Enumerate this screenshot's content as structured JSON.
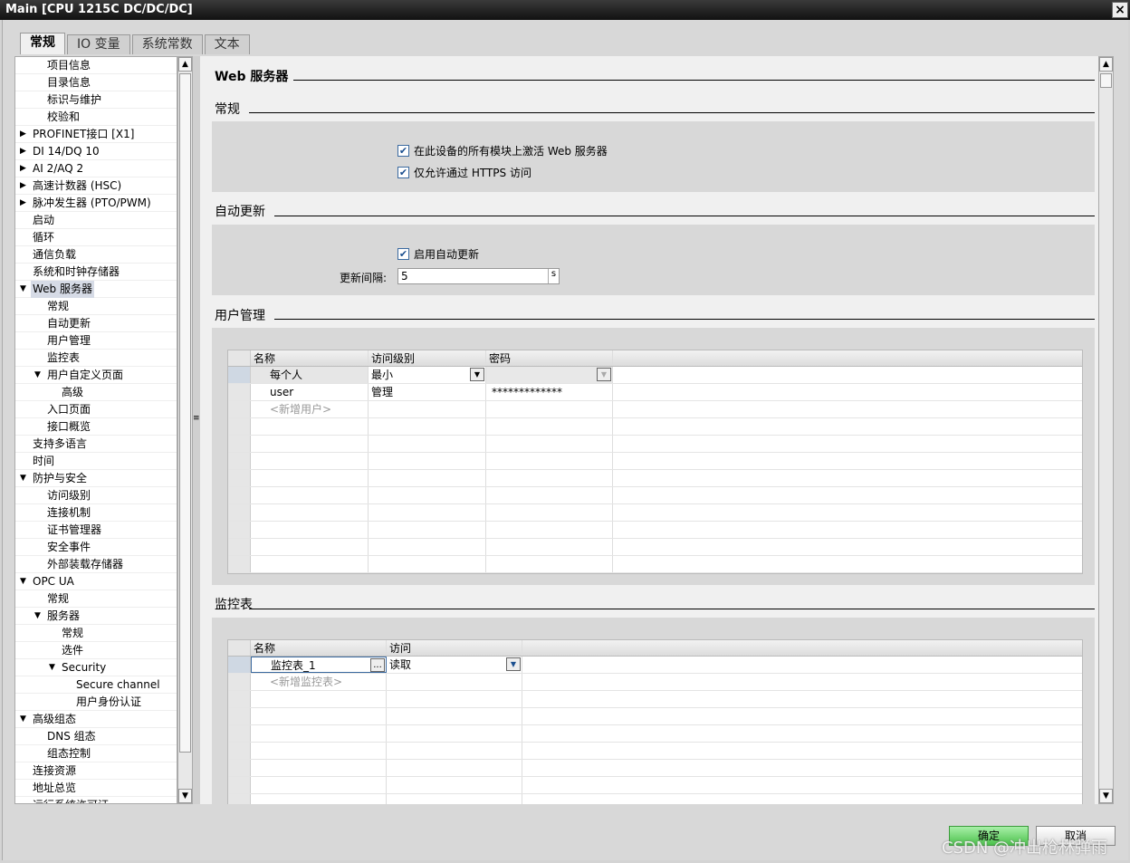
{
  "window": {
    "title": "Main [CPU 1215C DC/DC/DC]",
    "close": "×"
  },
  "tabs": [
    {
      "label": "常规",
      "active": true
    },
    {
      "label": "IO 变量"
    },
    {
      "label": "系统常数"
    },
    {
      "label": "文本"
    }
  ],
  "tree": [
    {
      "label": "项目信息",
      "level": 2
    },
    {
      "label": "目录信息",
      "level": 2
    },
    {
      "label": "标识与维护",
      "level": 2
    },
    {
      "label": "校验和",
      "level": 2
    },
    {
      "label": "PROFINET接口 [X1]",
      "level": 1,
      "exp": "collapsed"
    },
    {
      "label": "DI 14/DQ 10",
      "level": 1,
      "exp": "collapsed"
    },
    {
      "label": "AI 2/AQ 2",
      "level": 1,
      "exp": "collapsed"
    },
    {
      "label": "高速计数器 (HSC)",
      "level": 1,
      "exp": "collapsed"
    },
    {
      "label": "脉冲发生器 (PTO/PWM)",
      "level": 1,
      "exp": "collapsed"
    },
    {
      "label": "启动",
      "level": 1
    },
    {
      "label": "循环",
      "level": 1
    },
    {
      "label": "通信负载",
      "level": 1
    },
    {
      "label": "系统和时钟存储器",
      "level": 1
    },
    {
      "label": "Web 服务器",
      "level": 1,
      "exp": "expanded",
      "selected": true
    },
    {
      "label": "常规",
      "level": 2
    },
    {
      "label": "自动更新",
      "level": 2
    },
    {
      "label": "用户管理",
      "level": 2
    },
    {
      "label": "监控表",
      "level": 2
    },
    {
      "label": "用户自定义页面",
      "level": 2,
      "exp": "expanded"
    },
    {
      "label": "高级",
      "level": 3
    },
    {
      "label": "入口页面",
      "level": 2
    },
    {
      "label": "接口概览",
      "level": 2
    },
    {
      "label": "支持多语言",
      "level": 1
    },
    {
      "label": "时间",
      "level": 1
    },
    {
      "label": "防护与安全",
      "level": 1,
      "exp": "expanded"
    },
    {
      "label": "访问级别",
      "level": 2
    },
    {
      "label": "连接机制",
      "level": 2
    },
    {
      "label": "证书管理器",
      "level": 2
    },
    {
      "label": "安全事件",
      "level": 2
    },
    {
      "label": "外部装载存储器",
      "level": 2
    },
    {
      "label": "OPC UA",
      "level": 1,
      "exp": "expanded"
    },
    {
      "label": "常规",
      "level": 2
    },
    {
      "label": "服务器",
      "level": 2,
      "exp": "expanded"
    },
    {
      "label": "常规",
      "level": 3
    },
    {
      "label": "选件",
      "level": 3
    },
    {
      "label": "Security",
      "level": 3,
      "exp": "expanded"
    },
    {
      "label": "Secure channel",
      "level": 4
    },
    {
      "label": "用户身份认证",
      "level": 4
    },
    {
      "label": "高级组态",
      "level": 1,
      "exp": "expanded"
    },
    {
      "label": "DNS 组态",
      "level": 2
    },
    {
      "label": "组态控制",
      "level": 2
    },
    {
      "label": "连接资源",
      "level": 1
    },
    {
      "label": "地址总览",
      "level": 1
    },
    {
      "label": "运行系统许可证",
      "level": 1
    }
  ],
  "main": {
    "title": "Web 服务器",
    "general": {
      "heading": "常规",
      "cb1": "在此设备的所有模块上激活 Web 服务器",
      "cb1_checked": true,
      "cb2": "仅允许通过 HTTPS 访问",
      "cb2_checked": true
    },
    "autoupdate": {
      "heading": "自动更新",
      "cb": "启用自动更新",
      "cb_checked": true,
      "interval_label": "更新间隔:",
      "interval_value": "5",
      "unit": "s"
    },
    "users": {
      "heading": "用户管理",
      "columns": [
        "名称",
        "访问级别",
        "密码"
      ],
      "rows": [
        {
          "name": "每个人",
          "level": "最小",
          "password": ""
        },
        {
          "name": "user",
          "level": "管理",
          "password": "*************"
        }
      ],
      "add": "<新增用户>"
    },
    "watch": {
      "heading": "监控表",
      "columns": [
        "名称",
        "访问"
      ],
      "rows": [
        {
          "name": "监控表_1",
          "access": "读取"
        }
      ],
      "add": "<新增监控表>",
      "browse": "..."
    }
  },
  "buttons": {
    "ok": "确定",
    "cancel": "取消"
  },
  "watermark": "CSDN @冲出枪林弹雨",
  "colors": {
    "ok": "#5fcf5f",
    "selection": "#d6dbe6",
    "check": "#1b4f8f"
  }
}
